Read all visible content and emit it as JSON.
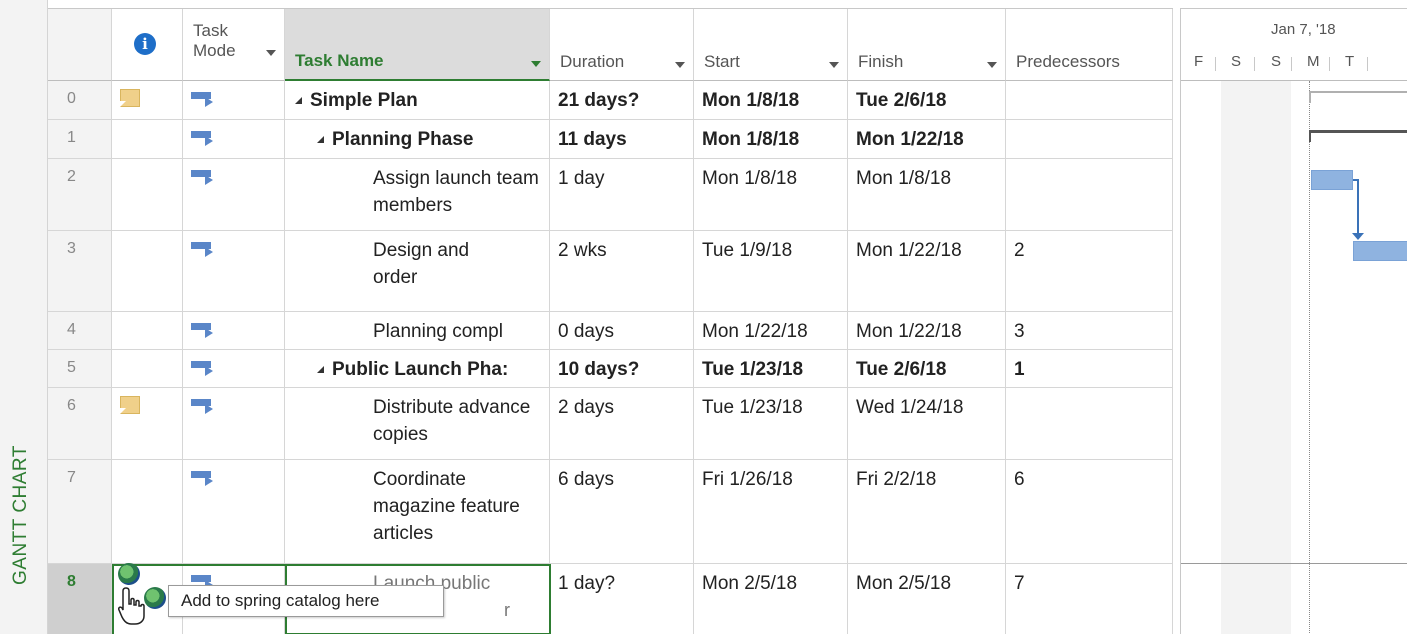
{
  "view_bar": {
    "label": "GANTT CHART"
  },
  "columns": {
    "info_icon": "info-icon",
    "task_mode": "Task\nMode",
    "task_mode_line1": "Task",
    "task_mode_line2": "Mode",
    "task_name": "Task Name",
    "duration": "Duration",
    "start": "Start",
    "finish": "Finish",
    "predecessors": "Predecessors"
  },
  "rows": [
    {
      "id": "0",
      "name": "Simple Plan",
      "duration": "21 days?",
      "start": "Mon 1/8/18",
      "finish": "Tue 2/6/18",
      "pred": "",
      "note": true,
      "summary": true
    },
    {
      "id": "1",
      "name": "Planning Phase",
      "duration": "11 days",
      "start": "Mon 1/8/18",
      "finish": "Mon 1/22/18",
      "pred": "",
      "note": false,
      "summary": true
    },
    {
      "id": "2",
      "name": "Assign launch team members",
      "duration": "1 day",
      "start": "Mon 1/8/18",
      "finish": "Mon 1/8/18",
      "pred": "",
      "note": false,
      "summary": false
    },
    {
      "id": "3",
      "name": "Design and order",
      "duration": "2 wks",
      "start": "Tue 1/9/18",
      "finish": "Mon 1/22/18",
      "pred": "2",
      "note": false,
      "summary": false
    },
    {
      "id": "4",
      "name": "Planning compl",
      "duration": "0 days",
      "start": "Mon 1/22/18",
      "finish": "Mon 1/22/18",
      "pred": "3",
      "note": false,
      "summary": false
    },
    {
      "id": "5",
      "name": "Public Launch Pha:",
      "duration": "10 days?",
      "start": "Tue 1/23/18",
      "finish": "Tue 2/6/18",
      "pred": "1",
      "note": false,
      "summary": true
    },
    {
      "id": "6",
      "name": "Distribute advance copies",
      "duration": "2 days",
      "start": "Tue 1/23/18",
      "finish": "Wed 1/24/18",
      "pred": "",
      "note": true,
      "summary": false
    },
    {
      "id": "7",
      "name": "Coordinate magazine feature articles",
      "duration": "6 days",
      "start": "Fri 1/26/18",
      "finish": "Fri 2/2/18",
      "pred": "6",
      "note": false,
      "summary": false
    },
    {
      "id": "8",
      "name": "Launch public",
      "duration": "1 day?",
      "start": "Mon 2/5/18",
      "finish": "Mon 2/5/18",
      "pred": "7",
      "note": false,
      "summary": false
    }
  ],
  "row8_partial": {
    "line1": "Launch public",
    "line2": "r"
  },
  "gantt": {
    "week_label": "Jan 7, '18",
    "days": [
      "F",
      "S",
      "S",
      "M",
      "T"
    ]
  },
  "tooltip": {
    "text": "Add to spring catalog here"
  },
  "icons": {
    "note": "note-icon",
    "task_mode": "auto-scheduled-task-icon",
    "globe": "globe-icon",
    "hand": "hand-cursor-icon"
  },
  "colors": {
    "accent_green": "#2e7d32",
    "bar_blue": "#8fb3e0",
    "link_blue": "#3a72b8",
    "info_blue": "#1e6ec8",
    "note_yellow": "#f0d08a"
  }
}
